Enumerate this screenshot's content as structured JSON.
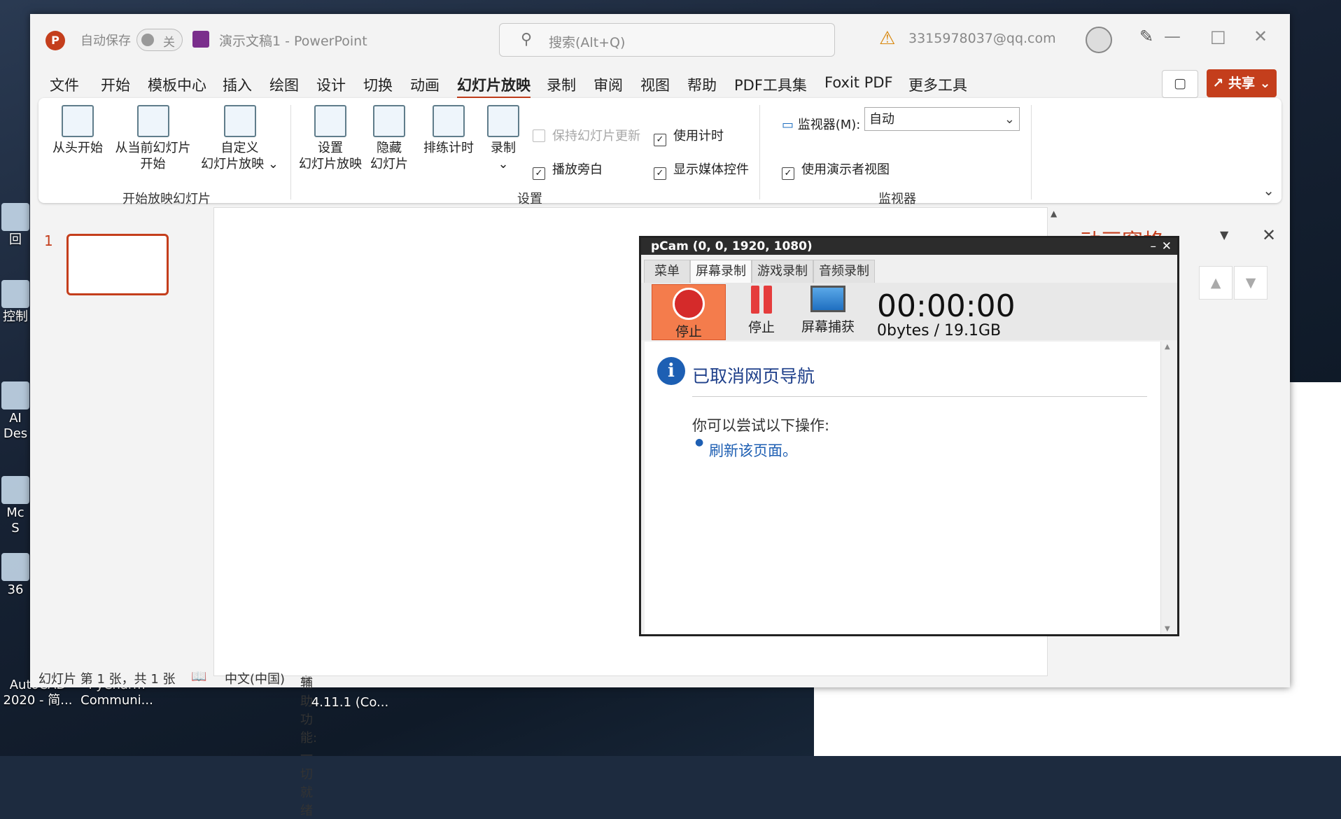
{
  "desktop": {
    "icons": [
      {
        "label": "回"
      },
      {
        "label": "控制"
      },
      {
        "label": "AI Des"
      },
      {
        "label": "Mc S"
      },
      {
        "label": "36"
      },
      {
        "label": "AutoCAD 2020 - 简..."
      },
      {
        "label": "PyCharm Communi..."
      },
      {
        "label": "4.11.1 (Co..."
      }
    ]
  },
  "ppt": {
    "titlebar": {
      "autosave_label": "自动保存",
      "autosave_state": "关",
      "doc_name": "演示文稿1  -  PowerPoint",
      "search_placeholder": "搜索(Alt+Q)",
      "account": "3315978037@qq.com"
    },
    "menu": [
      "文件",
      "开始",
      "模板中心",
      "插入",
      "绘图",
      "设计",
      "切换",
      "动画",
      "幻灯片放映",
      "录制",
      "审阅",
      "视图",
      "帮助",
      "PDF工具集",
      "Foxit PDF",
      "更多工具"
    ],
    "active_menu": "幻灯片放映",
    "share_label": "共享",
    "ribbon": {
      "from_start": "从头开始",
      "from_current_1": "从当前幻灯片",
      "from_current_2": "开始",
      "custom_1": "自定义",
      "custom_2": "幻灯片放映 ⌄",
      "group_start": "开始放映幻灯片",
      "setup_1": "设置",
      "setup_2": "幻灯片放映",
      "hide_1": "隐藏",
      "hide_2": "幻灯片",
      "rehearse": "排练计时",
      "record": "录制",
      "keep_updated": "保持幻灯片更新",
      "play_narration": "播放旁白",
      "use_timing": "使用计时",
      "show_media": "显示媒体控件",
      "group_setup": "设置",
      "monitor_label": "监视器(M):",
      "monitor_value": "自动",
      "presenter_view": "使用演示者视图",
      "group_monitor": "监视器"
    },
    "thumb_number": "1",
    "anim_pane_title": "动画窗格",
    "status": {
      "slide": "幻灯片 第 1 张，共 1 张",
      "language": "中文(中国)",
      "accessibility": "辅助功能: 一切就绪"
    }
  },
  "bandicam": {
    "title": "pCam (0, 0, 1920, 1080)",
    "tabs": [
      "菜单",
      "屏幕录制",
      "游戏录制",
      "音频录制"
    ],
    "active_tab": 1,
    "stop_label": "停止",
    "pause_label": "停止",
    "capture_label": "屏幕捕获",
    "timer": "00:00:00",
    "size": "0bytes / 19.1GB",
    "message_title": "已取消网页导航",
    "try_text": "你可以尝试以下操作:",
    "refresh_link": "刷新该页面。"
  }
}
